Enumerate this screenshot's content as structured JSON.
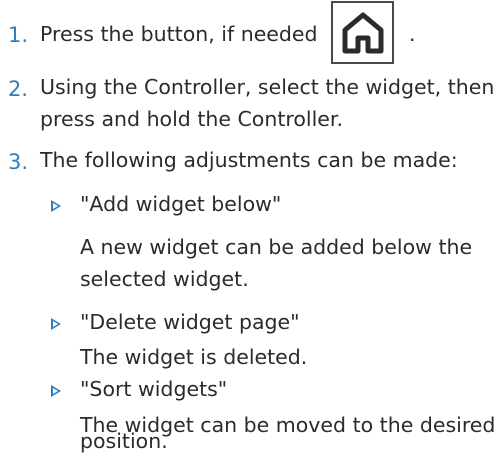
{
  "steps": [
    {
      "number": "1.",
      "text": "Press the button, if needed",
      "trailing": "."
    },
    {
      "number": "2.",
      "lines": [
        "Using the Controller, select the widget, then",
        "press and hold the Controller."
      ]
    },
    {
      "number": "3.",
      "text": "The following adjustments can be made:"
    }
  ],
  "home_button": {
    "icon": "home-icon"
  },
  "options": [
    {
      "title": "\"Add widget below\"",
      "description_lines": [
        "A new widget can be added below the",
        "selected widget."
      ]
    },
    {
      "title": "\"Delete widget page\"",
      "description_lines": [
        "The widget is deleted."
      ]
    },
    {
      "title": "\"Sort widgets\"",
      "description_lines": [
        "The widget can be moved to the desired",
        "position."
      ]
    }
  ],
  "colors": {
    "accent": "#2e7fc0",
    "text": "#2b2b2b"
  }
}
